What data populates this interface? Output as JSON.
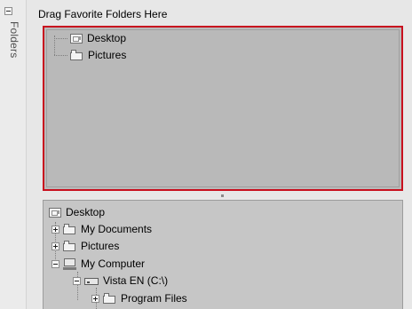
{
  "sidebar": {
    "label": "Folders"
  },
  "header": {
    "text": "Drag Favorite Folders Here"
  },
  "favorites": [
    {
      "label": "Desktop",
      "icon": "desktop-icon"
    },
    {
      "label": "Pictures",
      "icon": "folder-icon"
    }
  ],
  "tree": {
    "items": [
      {
        "label": "Desktop",
        "icon": "desktop-icon"
      },
      {
        "label": "My Documents",
        "icon": "folder-icon",
        "expander": "collapsed"
      },
      {
        "label": "Pictures",
        "icon": "folder-icon",
        "expander": "collapsed"
      },
      {
        "label": "My Computer",
        "icon": "computer-icon",
        "expander": "expanded"
      },
      {
        "label": "Vista EN (C:\\)",
        "icon": "drive-icon",
        "expander": "expanded"
      },
      {
        "label": "Program Files",
        "icon": "folder-icon",
        "expander": "collapsed"
      }
    ]
  },
  "colors": {
    "highlight_border": "#c8101e",
    "pane_background": "#b9b9b9"
  }
}
